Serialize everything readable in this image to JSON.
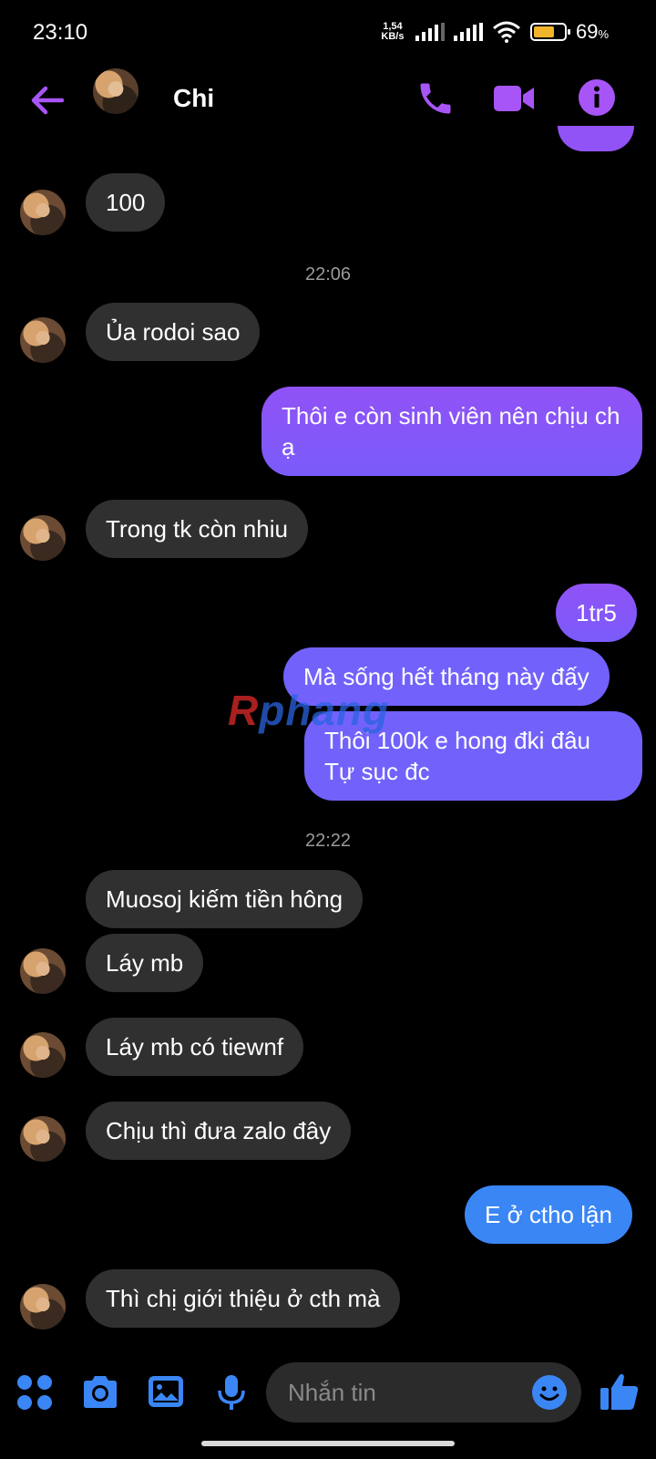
{
  "status_bar": {
    "time": "23:10",
    "net_speed_top": "1,54",
    "net_speed_bottom": "KB/s",
    "battery_percent": "69",
    "battery_percent_sign": "%",
    "battery_level": 0.69
  },
  "header": {
    "contact_name": "Chi",
    "icons": [
      "back-arrow-icon",
      "phone-icon",
      "video-camera-icon",
      "info-icon"
    ],
    "accent_color": "#a855f7"
  },
  "conversation": {
    "messages": [
      {
        "side": "in",
        "text": "100"
      },
      {
        "type": "timestamp",
        "text": "22:06"
      },
      {
        "side": "in",
        "text": "Ủa rodoi sao"
      },
      {
        "side": "out",
        "text": "Thôi e còn sinh viên nên chịu ch ạ"
      },
      {
        "side": "in",
        "text": "Trong tk còn nhiu"
      },
      {
        "side": "out",
        "text": "1tr5"
      },
      {
        "side": "out",
        "text": "Mà sống hết tháng này đấy"
      },
      {
        "side": "out",
        "text": "Thôi 100k e hong đki đâu Tự sục đc"
      },
      {
        "type": "timestamp",
        "text": "22:22"
      },
      {
        "side": "in",
        "text": "Muosoj kiếm tiền hông"
      },
      {
        "side": "in",
        "text": "Láy mb"
      },
      {
        "side": "in",
        "text": "Láy mb có tiewnf"
      },
      {
        "side": "in",
        "text": "Chịu thì đưa zalo đây"
      },
      {
        "side": "out",
        "text": "E ở ctho lận"
      },
      {
        "side": "in",
        "text": "Thì chị giới thiệu ở cth mà"
      }
    ]
  },
  "watermark": {
    "first": "R",
    "rest": "phang"
  },
  "composer": {
    "placeholder": "Nhắn tin",
    "icons": [
      "apps-grid-icon",
      "camera-icon",
      "gallery-icon",
      "microphone-icon",
      "emoji-icon",
      "like-thumb-icon"
    ]
  },
  "colors": {
    "background": "#000000",
    "incoming_bubble": "#303030",
    "outgoing_violet": "#9152f6",
    "outgoing_blue": "#3b86f5",
    "composer_icon": "#3b86f5"
  }
}
